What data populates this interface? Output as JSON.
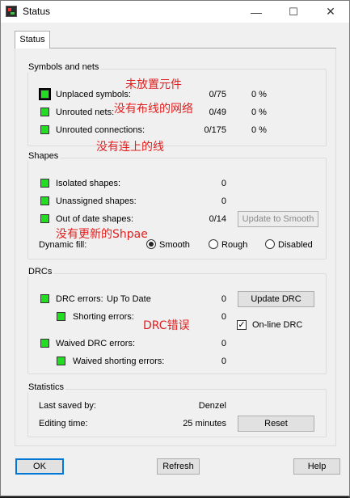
{
  "window": {
    "title": "Status",
    "minimize": "—",
    "maximize": "☐",
    "close": "✕"
  },
  "tab": {
    "label": "Status"
  },
  "symbols": {
    "title": "Symbols and nets",
    "rows": [
      {
        "label": "Unplaced symbols:",
        "count": "0/75",
        "percent": "0 %"
      },
      {
        "label": "Unrouted nets:",
        "count": "0/49",
        "percent": "0 %"
      },
      {
        "label": "Unrouted connections:",
        "count": "0/175",
        "percent": "0 %"
      }
    ]
  },
  "shapes": {
    "title": "Shapes",
    "rows": [
      {
        "label": "Isolated shapes:",
        "count": "0"
      },
      {
        "label": "Unassigned shapes:",
        "count": "0"
      },
      {
        "label": "Out of date shapes:",
        "count": "0/14"
      }
    ],
    "update_button": "Update to Smooth",
    "dynamic_fill_label": "Dynamic fill:",
    "fill_options": [
      "Smooth",
      "Rough",
      "Disabled"
    ],
    "fill_selected": "Smooth"
  },
  "drcs": {
    "title": "DRCs",
    "drc_errors_label": "DRC errors:",
    "drc_status": "Up To Date",
    "drc_errors_count": "0",
    "shorting_label": "Shorting errors:",
    "shorting_count": "0",
    "waived_label": "Waived DRC errors:",
    "waived_count": "0",
    "waived_shorting_label": "Waived shorting errors:",
    "waived_shorting_count": "0",
    "update_drc_button": "Update DRC",
    "online_drc_label": "On-line DRC",
    "online_drc_checked": true
  },
  "statistics": {
    "title": "Statistics",
    "last_saved_label": "Last saved by:",
    "last_saved_value": "Denzel",
    "editing_time_label": "Editing time:",
    "editing_time_value": "25 minutes",
    "reset_button": "Reset"
  },
  "footer": {
    "ok": "OK",
    "refresh": "Refresh",
    "help": "Help"
  },
  "annotations": {
    "unplaced": "未放置元件",
    "unrouted": "没有布线的网络",
    "unconnected": "没有连上的线",
    "out_of_date": "没有更新的Shpae",
    "drc": "DRC错误"
  },
  "colors": {
    "indicator": "#22dd22",
    "annotation": "#e02020",
    "accent": "#0078d7"
  }
}
